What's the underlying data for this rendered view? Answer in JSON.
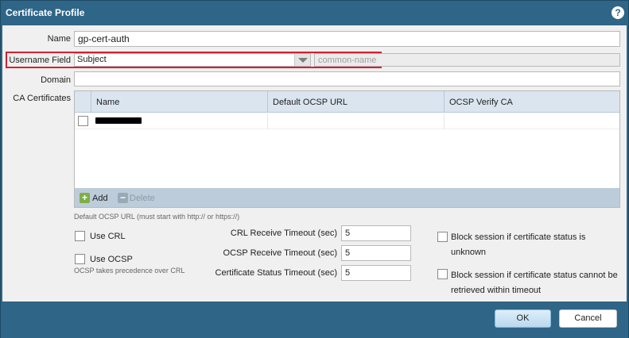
{
  "dialog": {
    "title": "Certificate Profile",
    "help_label": "?"
  },
  "form": {
    "name_label": "Name",
    "name_value": "gp-cert-auth",
    "username_field_label": "Username Field",
    "username_field_value": "Subject",
    "username_subfield_placeholder": "common-name",
    "domain_label": "Domain",
    "domain_value": "",
    "ca_label": "CA Certificates"
  },
  "ca_grid": {
    "columns": [
      "Name",
      "Default OCSP URL",
      "OCSP Verify CA"
    ],
    "rows": [
      {
        "checked": false,
        "name": "",
        "ocsp_url": "",
        "ocsp_verify_ca": ""
      }
    ],
    "add_label": "Add",
    "delete_label": "Delete"
  },
  "hints": {
    "ocsp_url": "Default OCSP URL (must start with http:// or https://)",
    "ocsp_precedence": "OCSP takes precedence over CRL"
  },
  "options": {
    "use_crl": "Use CRL",
    "use_ocsp": "Use OCSP",
    "crl_timeout_label": "CRL Receive Timeout (sec)",
    "crl_timeout_value": "5",
    "ocsp_timeout_label": "OCSP Receive Timeout (sec)",
    "ocsp_timeout_value": "5",
    "cert_status_timeout_label": "Certificate Status Timeout (sec)",
    "cert_status_timeout_value": "5",
    "block_unknown_line1": "Block session if certificate status is",
    "block_unknown_line2": "unknown",
    "block_timeout_line1": "Block session if certificate status cannot be",
    "block_timeout_line2": "retrieved within timeout"
  },
  "buttons": {
    "ok": "OK",
    "cancel": "Cancel"
  },
  "colors": {
    "titlebar": "#2f6587",
    "highlight": "#d6202c",
    "grid_header": "#dbe5ef",
    "grid_toolbar": "#bcccda"
  }
}
